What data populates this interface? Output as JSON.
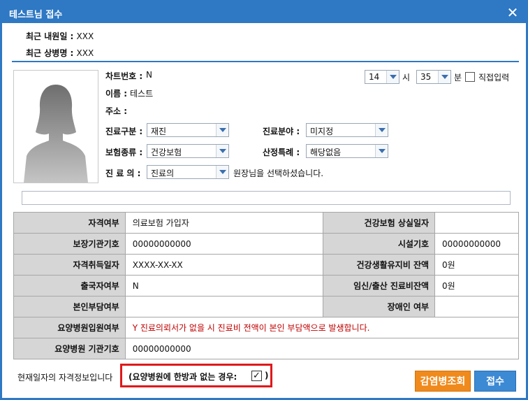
{
  "title": "테스트님 접수",
  "recent": {
    "visit_label": "최근 내원일 : ",
    "visit_value": "XXX",
    "disease_label": "최근 상병명 : ",
    "disease_value": "XXX"
  },
  "patient": {
    "chart_label": "차트번호 : ",
    "chart_value": "N",
    "name_label": "이름 : ",
    "name_value": "테스트",
    "address_label": "주소 : "
  },
  "time": {
    "hour": "14",
    "hour_unit": "시",
    "minute": "35",
    "minute_unit": "분",
    "manual_label": "직접입력"
  },
  "form": {
    "visit_type_label": "진료구분 : ",
    "visit_type_value": "재진",
    "department_label": "진료분야 : ",
    "department_value": "미지정",
    "insurance_label": "보험종류 : ",
    "insurance_value": "건강보험",
    "special_label": "산정특례 : ",
    "special_value": "해당없음",
    "doctor_label": "진 료 의 : ",
    "doctor_value": "진료의",
    "doctor_suffix": "원장님을 선택하셨습니다."
  },
  "grid": [
    {
      "h1": "자격여부",
      "v1": "의료보험 가입자",
      "h2": "건강보험 상실일자",
      "v2": ""
    },
    {
      "h1": "보장기관기호",
      "v1": "00000000000",
      "h2": "시설기호",
      "v2": "00000000000"
    },
    {
      "h1": "자격취득일자",
      "v1": "XXXX-XX-XX",
      "h2": "건강생활유지비 잔액",
      "v2": "0원"
    },
    {
      "h1": "출국자여부",
      "v1": "N",
      "h2": "임신/출산 진료비잔액",
      "v2": "0원"
    },
    {
      "h1": "본인부담여부",
      "v1": "",
      "h2": "장애인 여부",
      "v2": ""
    }
  ],
  "grid_full": [
    {
      "h": "요양병원입원여부",
      "v": "Y 진료의뢰서가 없을 시 진료비 전액이 본인 부담액으로 발생합니다."
    },
    {
      "h": "요양병원 기관기호",
      "v": "00000000000"
    }
  ],
  "footer": {
    "note": "현재일자의 자격정보입니다",
    "redbox_text": "(요양병원에 한방과 없는 경우:",
    "redbox_close": ")",
    "check_mark": "✓",
    "btn_disease": "감염병조회",
    "btn_register": "접수"
  },
  "colors": {
    "title_bar": "#2e78c4",
    "orange_button": "#f08a1c",
    "blue_button": "#3c89d4",
    "highlight_box": "#e0181b",
    "warning_text": "#c00000"
  }
}
